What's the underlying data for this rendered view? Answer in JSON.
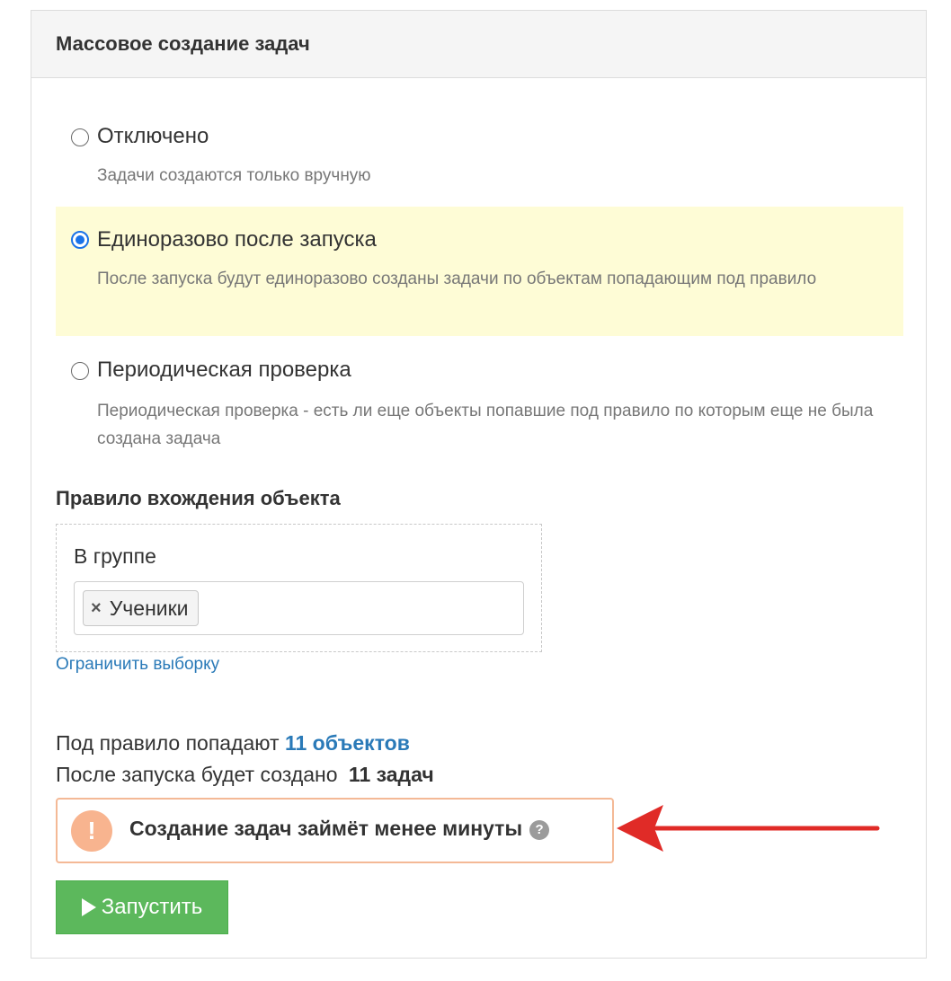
{
  "panel": {
    "title": "Массовое создание задач"
  },
  "options": [
    {
      "title": "Отключено",
      "description": "Задачи создаются только вручную",
      "selected": false
    },
    {
      "title": "Единоразово после запуска",
      "description": "После запуска будут единоразово созданы задачи по объектам попадающим под правило",
      "selected": true
    },
    {
      "title": "Периодическая проверка",
      "description": "Периодическая проверка - есть ли еще объекты попавшие под правило по которым еще не была создана задача",
      "selected": false
    }
  ],
  "rule": {
    "section_title": "Правило вхождения объекта",
    "group_label": "В группе",
    "tags": [
      {
        "label": "Ученики"
      }
    ],
    "limit_link": "Ограничить выборку"
  },
  "summary": {
    "matched_prefix": "Под правило попадают",
    "matched_count": "11 объектов",
    "created_prefix": "После запуска будет создано",
    "created_count": "11 задач"
  },
  "alert": {
    "icon": "!",
    "text": "Создание задач займёт менее минуты",
    "help_icon": "?"
  },
  "run_button": {
    "label": "Запустить"
  },
  "colors": {
    "header_bg": "#f5f5f5",
    "selected_bg": "#fefcd6",
    "radio_checked": "#1a73e8",
    "link": "#2a7ab8",
    "alert_border": "#f4b996",
    "alert_icon_bg": "#f8b48f",
    "run_button": "#5cb85c",
    "annotation_arrow": "#e02b27"
  }
}
